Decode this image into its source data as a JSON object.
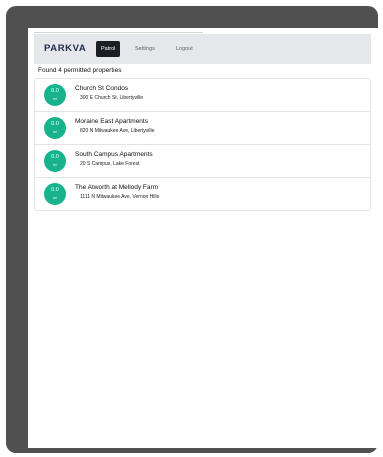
{
  "navbar": {
    "brand": "PARKVA",
    "links": [
      {
        "label": "Patrol",
        "active": true
      },
      {
        "label": "Settings",
        "active": false
      },
      {
        "label": "Logout",
        "active": false
      }
    ]
  },
  "results": {
    "summary": "Found 4 permitted properties",
    "properties": [
      {
        "distance": "0.0",
        "unit": "mi",
        "name": "Church St Condos",
        "address": "300 E Church St, Libertyville"
      },
      {
        "distance": "0.0",
        "unit": "mi",
        "name": "Moraine East Apartments",
        "address": "820 N Milwaukee Ave, Libertyville"
      },
      {
        "distance": "0.0",
        "unit": "mi",
        "name": "South Campus Apartments",
        "address": "20 S Campus, Lake Forest"
      },
      {
        "distance": "0.0",
        "unit": "mi",
        "name": "The Atworth at Mellody Farm",
        "address": "1111 N Milwaukee Ave, Vernon Hills"
      }
    ]
  },
  "colors": {
    "badge": "#18b28c",
    "brand": "#1e2b4c",
    "active_nav": "#1b1e23",
    "device_frame": "#505050"
  }
}
